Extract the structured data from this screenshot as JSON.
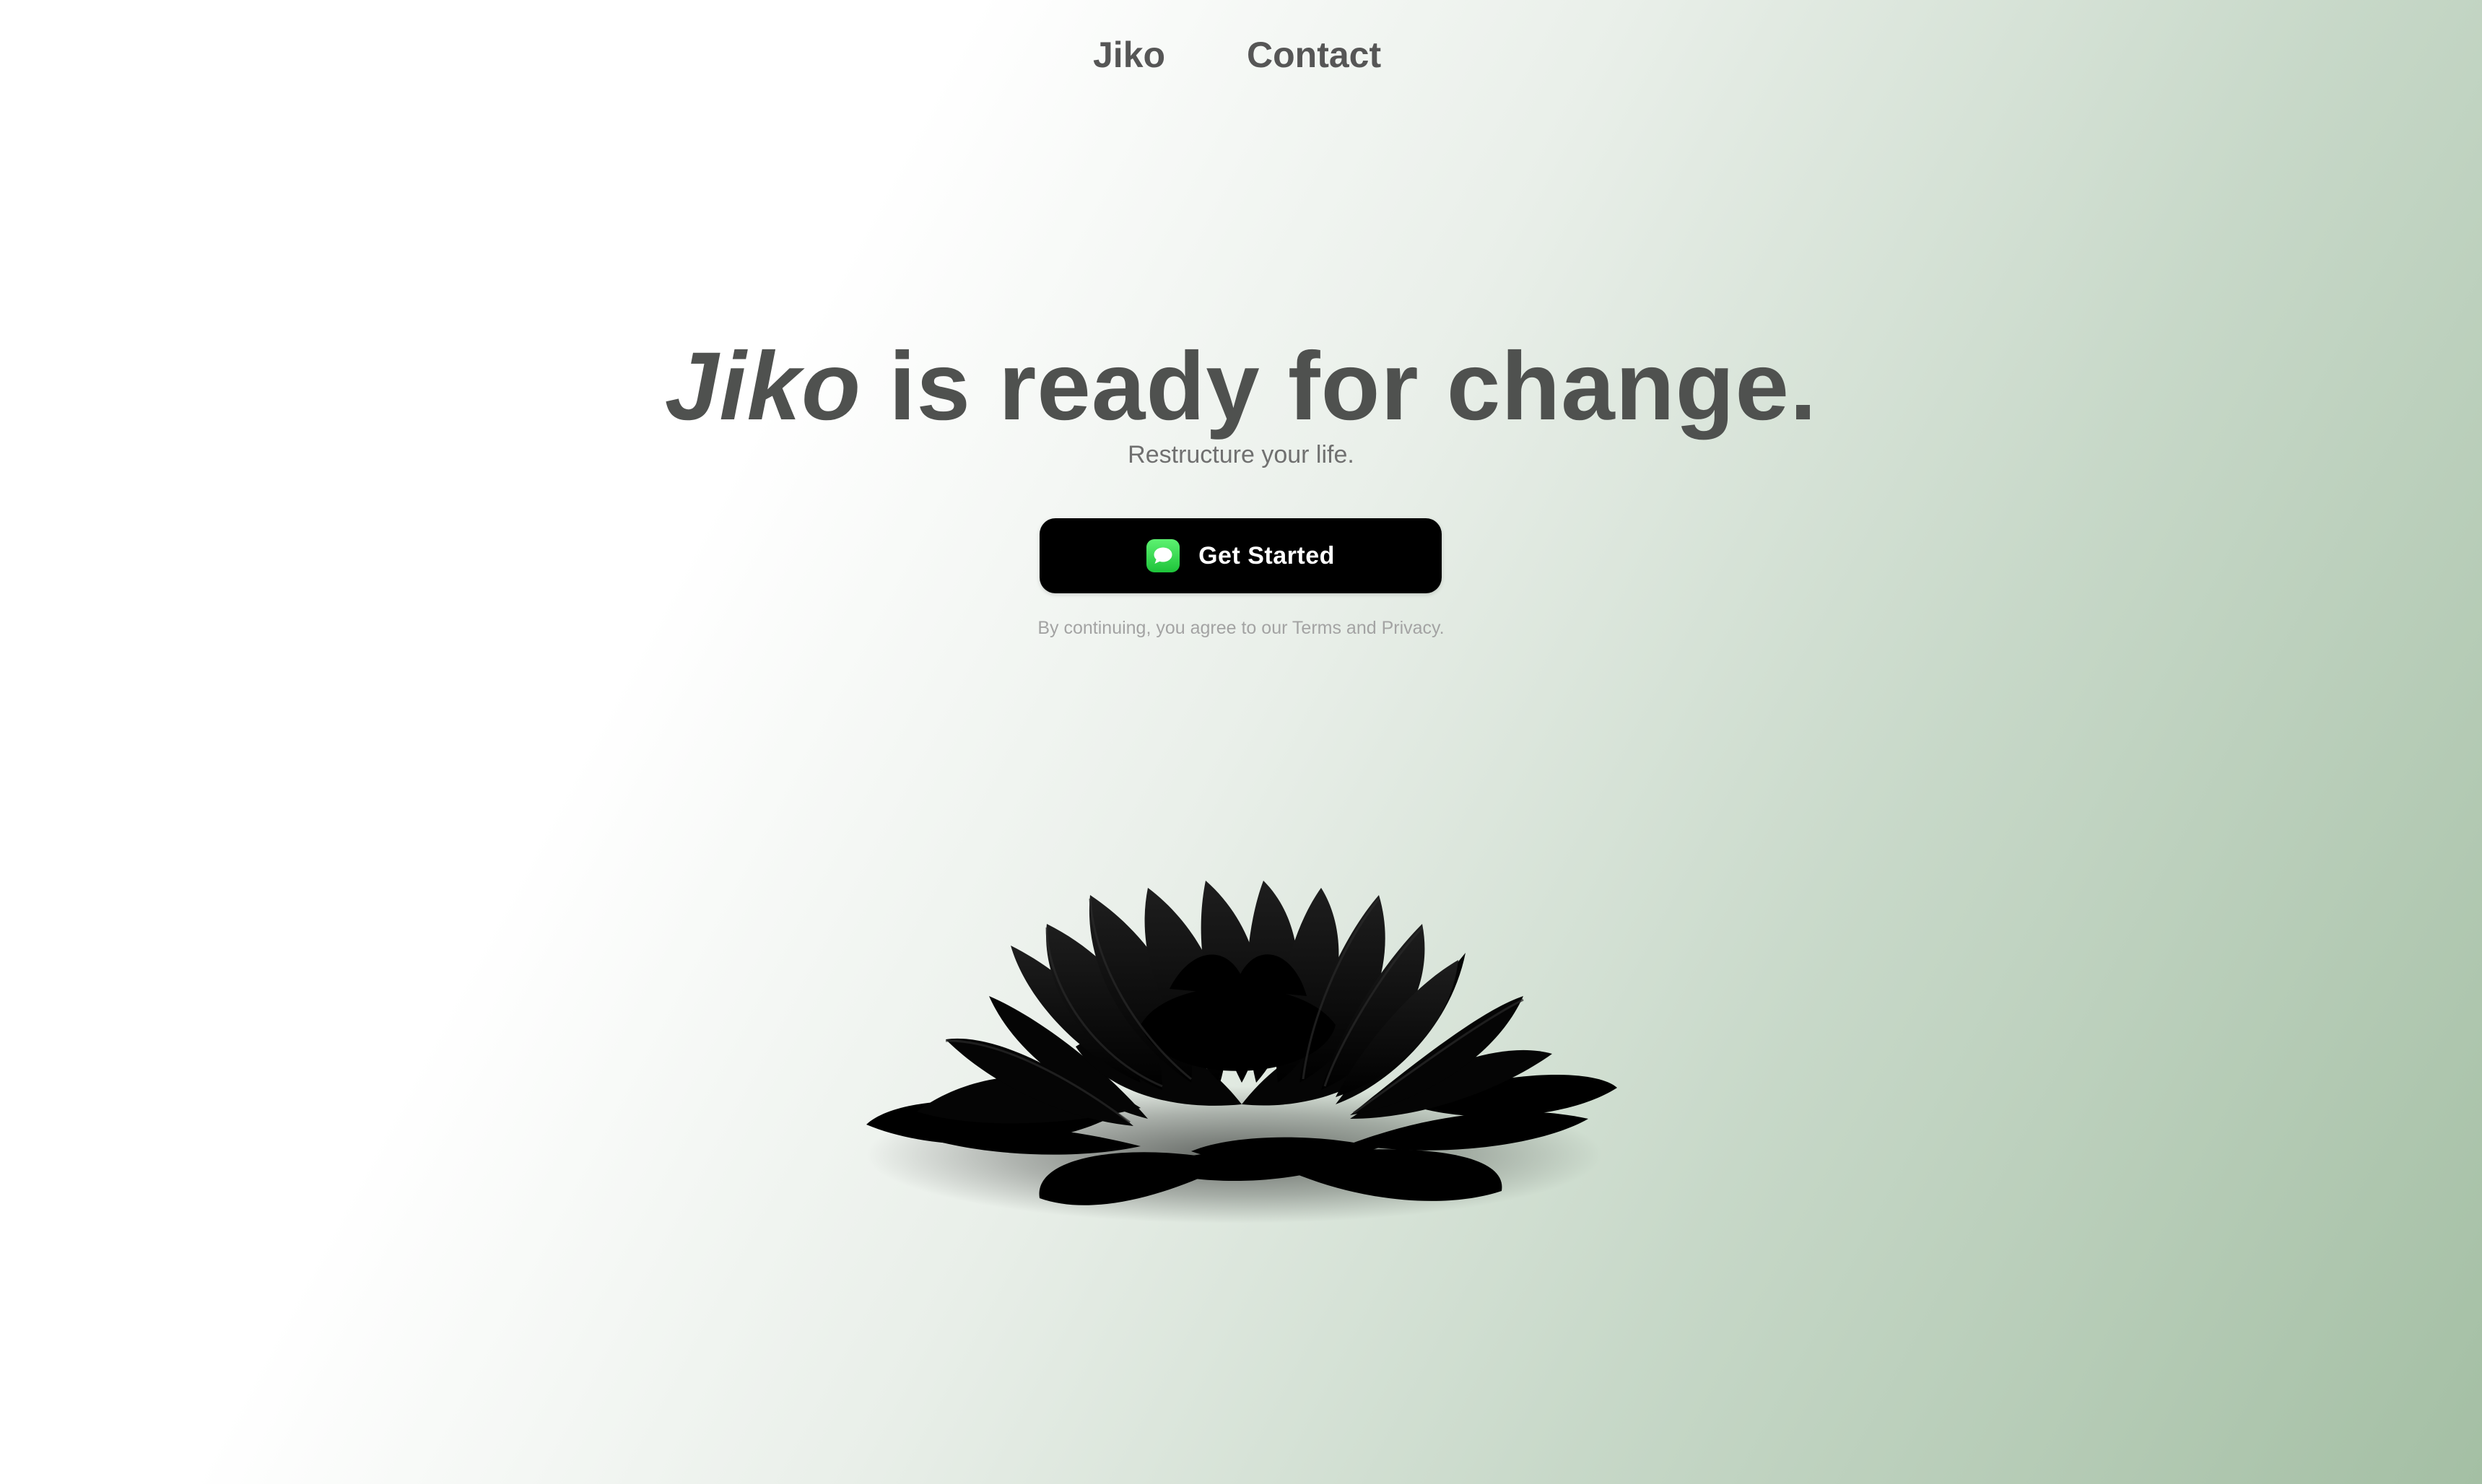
{
  "nav": {
    "items": [
      {
        "label": "Jiko"
      },
      {
        "label": "Contact"
      }
    ]
  },
  "hero": {
    "title_brand": "Jiko",
    "title_rest": " is ready for change.",
    "subtitle": "Restructure your life."
  },
  "cta": {
    "label": "Get Started",
    "icon": "messages-icon",
    "icon_color": "#34c759"
  },
  "legal": {
    "text": "By continuing, you agree to our Terms and Privacy."
  },
  "illustration": {
    "name": "black-lotus",
    "color": "#000000"
  },
  "colors": {
    "heading": "#4f514f",
    "button_bg": "#000000",
    "gradient_end": "#a4bfa4"
  }
}
